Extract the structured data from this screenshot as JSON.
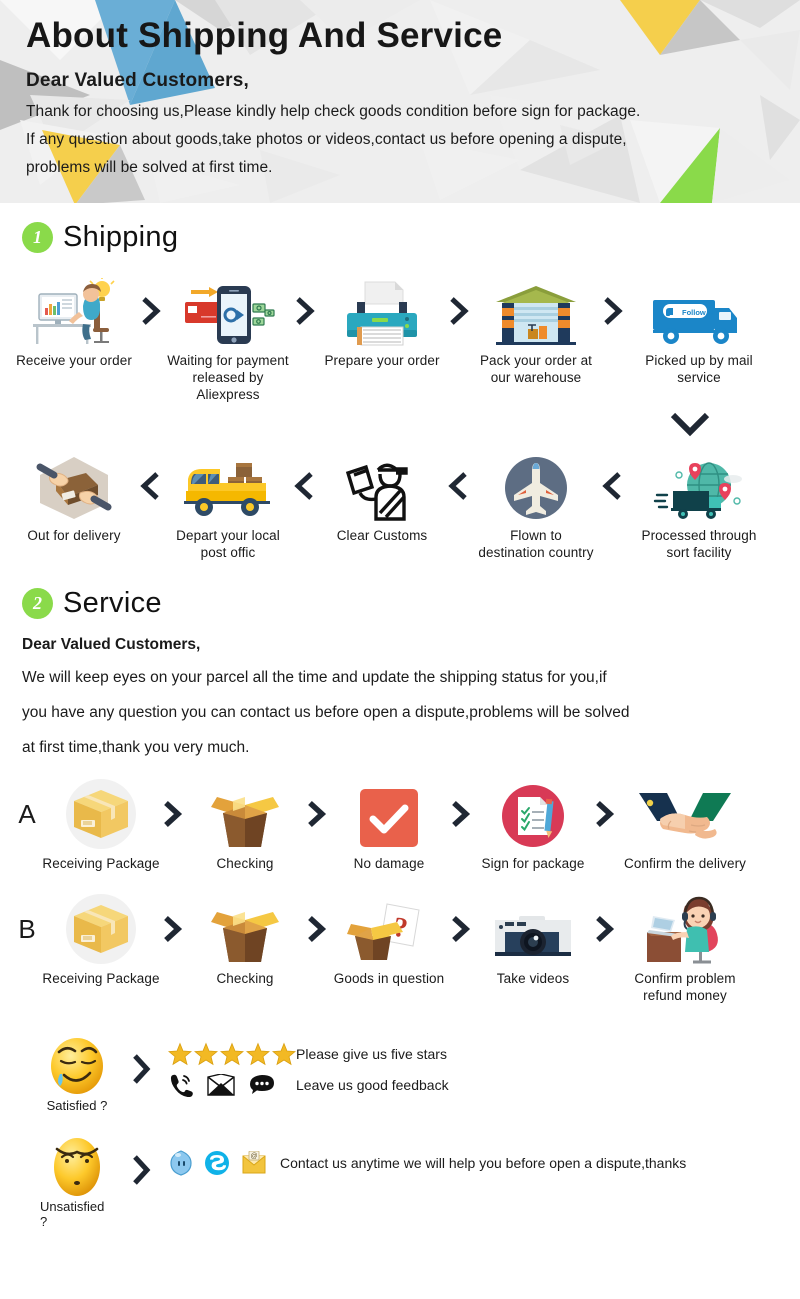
{
  "header": {
    "title": "About Shipping And Service",
    "salutation": "Dear Valued Customers,",
    "lines": [
      "Thank for choosing us,Please kindly help check goods condition before sign for package.",
      "If any question about goods,take photos or videos,contact us before opening a dispute,",
      "problems will be solved at first time."
    ],
    "bg_color": "#eeeeee",
    "accent_blue": "#6aaed6",
    "accent_yellow": "#f5cf4c",
    "accent_green": "#8ada4a",
    "accent_grey": "#c6c6c6"
  },
  "sections": [
    {
      "number": "1",
      "title": "Shipping",
      "badge_color": "#8ada4a"
    },
    {
      "number": "2",
      "title": "Service",
      "badge_color": "#8ada4a"
    }
  ],
  "shipping": {
    "row1": {
      "direction": "left-to-right",
      "steps": [
        {
          "icon": "person-at-desk-icon",
          "label": "Receive your order"
        },
        {
          "icon": "mobile-payment-icon",
          "label": "Waiting for payment\nreleased by Aliexpress"
        },
        {
          "icon": "printer-icon",
          "label": "Prepare your order"
        },
        {
          "icon": "warehouse-icon",
          "label": "Pack your order at\nour warehouse"
        },
        {
          "icon": "mail-truck-icon",
          "label": "Picked up by mail service"
        }
      ]
    },
    "row1_connector": "chevron-down-icon",
    "row2": {
      "direction": "right-to-left",
      "steps": [
        {
          "icon": "hands-package-icon",
          "label": "Out for delivery"
        },
        {
          "icon": "delivery-van-icon",
          "label": "Depart your local\npost offic"
        },
        {
          "icon": "customs-officer-icon",
          "label": "Clear Customs"
        },
        {
          "icon": "airplane-icon",
          "label": "Flown to\ndestination country"
        },
        {
          "icon": "globe-sort-facility-icon",
          "label": "Processed through\nsort facility"
        }
      ]
    }
  },
  "service": {
    "lead": "Dear Valued Customers,",
    "lines": [
      "We will keep eyes on your parcel all the time and update the shipping status for you,if",
      "you have any question you can contact us before open a dispute,problems will be solved",
      "at first time,thank you very much."
    ],
    "rowA": {
      "letter": "A",
      "steps": [
        {
          "icon": "closed-box-icon",
          "label": "Receiving Package"
        },
        {
          "icon": "open-box-icon",
          "label": "Checking"
        },
        {
          "icon": "checkmark-square-icon",
          "label": "No damage"
        },
        {
          "icon": "signed-document-icon",
          "label": "Sign for package"
        },
        {
          "icon": "handshake-icon",
          "label": "Confirm the delivery"
        }
      ]
    },
    "rowB": {
      "letter": "B",
      "steps": [
        {
          "icon": "closed-box-icon",
          "label": "Receiving Package"
        },
        {
          "icon": "open-box-icon",
          "label": "Checking"
        },
        {
          "icon": "question-box-icon",
          "label": "Goods in question"
        },
        {
          "icon": "camera-icon",
          "label": "Take videos"
        },
        {
          "icon": "support-agent-icon",
          "label": "Confirm problem\nrefund money"
        }
      ]
    }
  },
  "feedback": {
    "satisfied": {
      "face_icon": "satisfied-emoji-icon",
      "caption": "Satisfied ?",
      "chevron": "chevron-right-icon",
      "lines": [
        {
          "icons": [
            "star-icon",
            "star-icon",
            "star-icon",
            "star-icon",
            "star-icon"
          ],
          "text": "Please give us five stars"
        },
        {
          "icons": [
            "phone-icon",
            "envelope-icon",
            "chat-bubble-icon"
          ],
          "text": "Leave us good feedback"
        }
      ]
    },
    "unsatisfied": {
      "face_icon": "unsatisfied-emoji-icon",
      "caption": "Unsatisfied ?",
      "chevron": "chevron-right-icon",
      "lines": [
        {
          "icons": [
            "messenger-icon",
            "skype-icon",
            "email-icon"
          ],
          "text": "Contact us anytime we will help you before open a dispute,thanks"
        }
      ]
    },
    "star_color": "#f2b924"
  }
}
